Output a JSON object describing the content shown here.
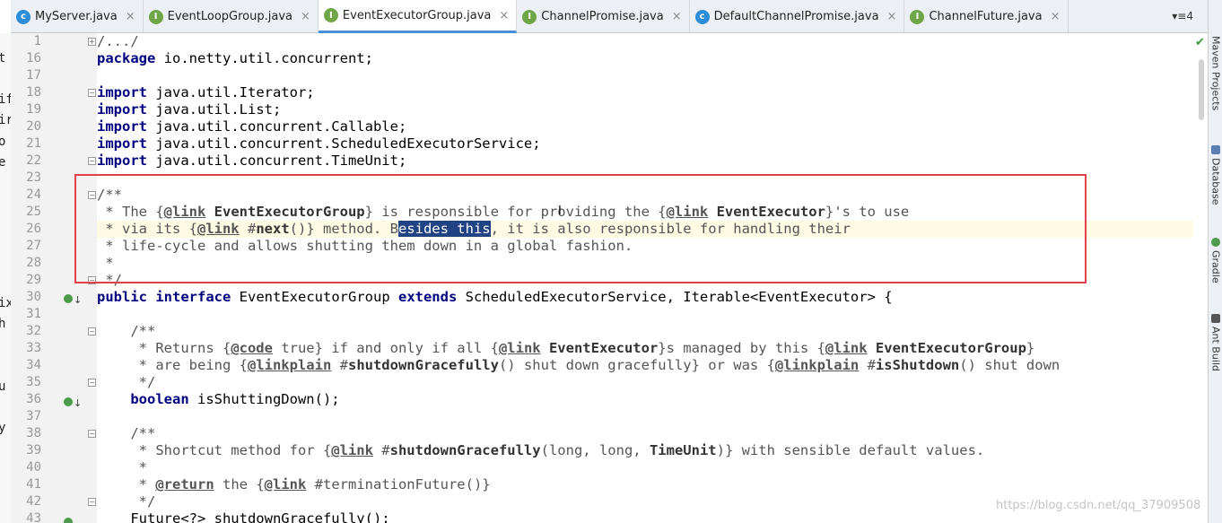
{
  "tabs": [
    {
      "label": "MyServer.java",
      "kind": "c",
      "active": false
    },
    {
      "label": "EventLoopGroup.java",
      "kind": "i",
      "active": false
    },
    {
      "label": "EventExecutorGroup.java",
      "kind": "i",
      "active": true
    },
    {
      "label": "ChannelPromise.java",
      "kind": "i",
      "active": false
    },
    {
      "label": "DefaultChannelPromise.java",
      "kind": "c",
      "active": false
    },
    {
      "label": "ChannelFuture.java",
      "kind": "i",
      "active": false
    }
  ],
  "tab_close_glyph": "×",
  "tab_overflow": "▾≡4",
  "left_pane_chars": [
    "t",
    "if",
    "ir",
    "o",
    "e",
    "ix",
    "h",
    "u",
    "y"
  ],
  "right_tools": [
    "Maven Projects",
    "Database",
    "Gradle",
    "Ant Build"
  ],
  "colors": {
    "annotation_box": "#e2404a",
    "selection": "#214283",
    "caret_line": "#fffae3",
    "keyword": "#000080"
  },
  "gutter": {
    "line_numbers": [
      "1",
      "16",
      "17",
      "18",
      "19",
      "20",
      "21",
      "22",
      "23",
      "24",
      "25",
      "26",
      "27",
      "28",
      "29",
      "30",
      "31",
      "32",
      "33",
      "34",
      "35",
      "36",
      "37",
      "38",
      "39",
      "40",
      "41",
      "42",
      "43"
    ],
    "implementation_markers": [
      "30",
      "36",
      "43"
    ]
  },
  "code": {
    "l1": {
      "a": "/.../"
    },
    "l16": {
      "kw": "package",
      "rest": " io.netty.util.concurrent;"
    },
    "l18": {
      "kw": "import",
      "rest": " java.util.Iterator;"
    },
    "l19": {
      "kw": "import",
      "rest": " java.util.List;"
    },
    "l20": {
      "kw": "import",
      "rest": " java.util.concurrent.Callable;"
    },
    "l21": {
      "kw": "import",
      "rest": " java.util.concurrent.ScheduledExecutorService;"
    },
    "l22": {
      "kw": "import",
      "rest": " java.util.concurrent.TimeUnit;"
    },
    "l24": {
      "a": "/**"
    },
    "l25": {
      "a": " * The {",
      "tag1": "@link",
      "b": " EventExecutorGroup",
      "c": "} is responsible for providing the {",
      "tag2": "@link",
      "d": " EventExecutor",
      "e": "}'s to use"
    },
    "l26": {
      "a": " * via its {",
      "tag": "@link",
      "b": " #",
      "c": "next",
      "d": "()} method. B",
      "sel": "esides this",
      "e": ", it is also responsible for handling their"
    },
    "l27": {
      "a": " * life-cycle and allows shutting them down in a global fashion."
    },
    "l28": {
      "a": " *"
    },
    "l29": {
      "a": " */"
    },
    "l30": {
      "kw1": "public",
      "kw2": "interface",
      "name": " EventExecutorGroup ",
      "kw3": "extends",
      "rest": " ScheduledExecutorService, Iterable<EventExecutor> {"
    },
    "l32": {
      "a": "    /**"
    },
    "l33": {
      "a": "     * Returns {",
      "tag1": "@code",
      "b": " true} if and only if all {",
      "tag2": "@link",
      "c": " EventExecutor",
      "d": "}s managed by this {",
      "tag3": "@link",
      "e": " EventExecutorGroup",
      "f": "}"
    },
    "l34": {
      "a": "     * are being {",
      "tag1": "@linkplain",
      "b": " #",
      "c": "shutdownGracefully",
      "d": "() shut down gracefully} or was {",
      "tag2": "@linkplain",
      "e": " #",
      "f": "isShutdown",
      "g": "() shut down"
    },
    "l35": {
      "a": "     */"
    },
    "l36": {
      "kw": "    boolean",
      "rest": " isShuttingDown();"
    },
    "l38": {
      "a": "    /**"
    },
    "l39": {
      "a": "     * Shortcut method for {",
      "tag": "@link",
      "b": " #",
      "c": "shutdownGracefully",
      "d": "(long, long, ",
      "e": "TimeUnit",
      "f": ")} with sensible default values."
    },
    "l40": {
      "a": "     *"
    },
    "l41": {
      "a": "     * ",
      "tag1": "@return",
      "b": " the {",
      "tag2": "@link",
      "c": " #terminationFuture()}"
    },
    "l42": {
      "a": "     */"
    },
    "l43": {
      "a": "    Future<?> shutdownGracefully();"
    }
  },
  "watermark": "https://blog.csdn.net/qq_37909508",
  "check_icon": "✔",
  "text_cursor": "I"
}
